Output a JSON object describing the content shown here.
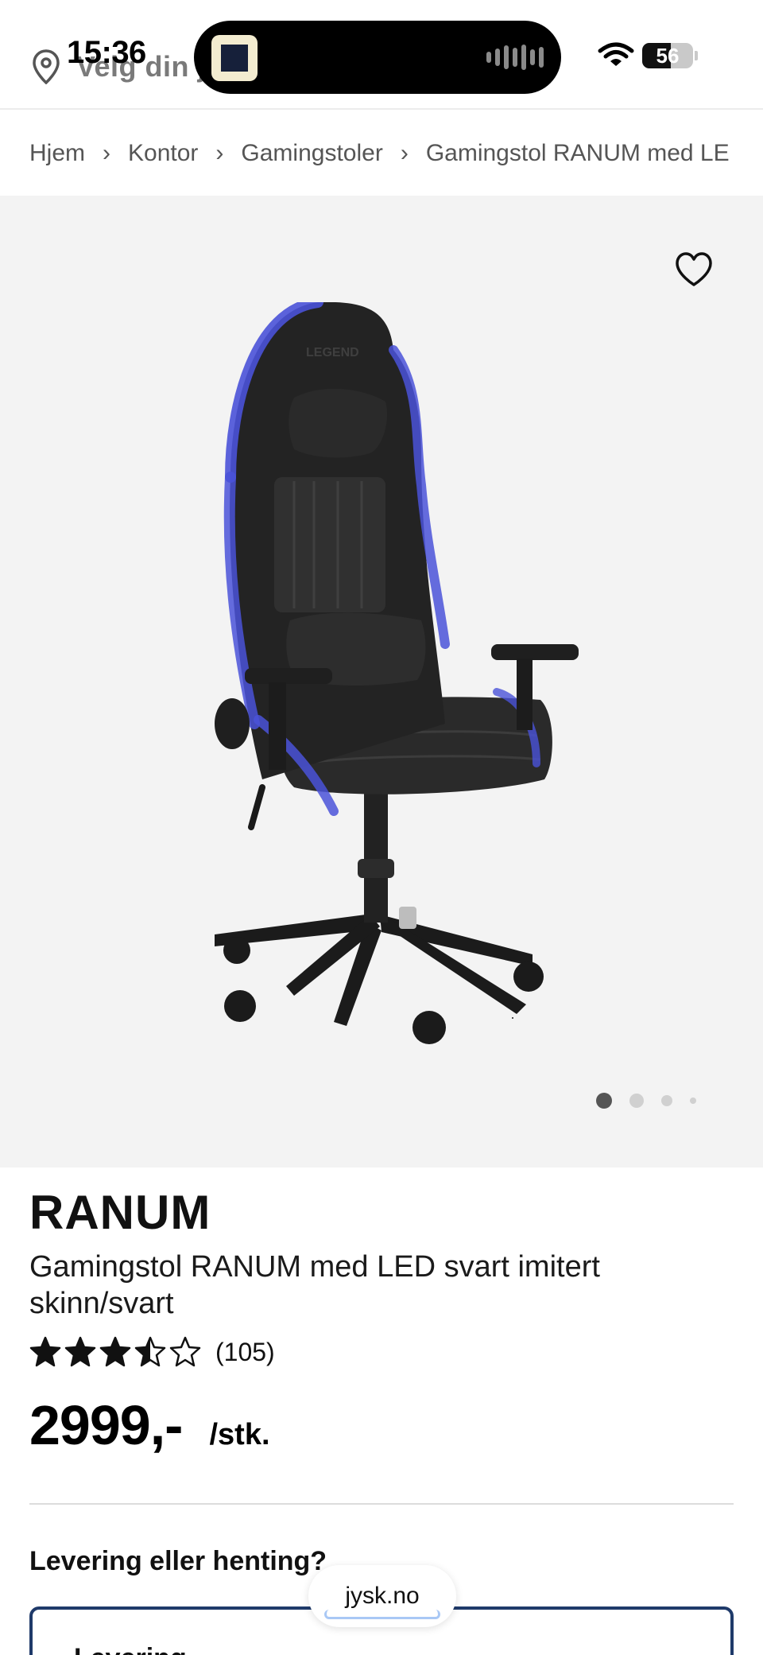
{
  "status_bar": {
    "time": "15:36",
    "location_text": "Velg din j",
    "battery": "56",
    "battery_level": 0.56
  },
  "breadcrumb": {
    "items": [
      "Hjem",
      "Kontor",
      "Gamingstoler",
      "Gamingstol RANUM med LE"
    ],
    "separator": "›"
  },
  "gallery": {
    "image_alt": "Gamingstol RANUM med LED",
    "chair_logo": "LEGEND",
    "dot_count": 4,
    "active_dot": 0
  },
  "product": {
    "name": "RANUM",
    "description": "Gamingstol RANUM med LED svart imitert skinn/svart",
    "rating_value": 3.5,
    "rating_max": 5,
    "review_count": "(105)",
    "price": "2999,-",
    "unit": "/stk."
  },
  "delivery": {
    "heading": "Levering eller henting?",
    "option_label": "Levering"
  },
  "browser": {
    "url": "jysk.no"
  },
  "colors": {
    "accent_border": "#1f3a6a",
    "led_blue": "#4a52d8",
    "gallery_bg": "#f3f3f3"
  }
}
